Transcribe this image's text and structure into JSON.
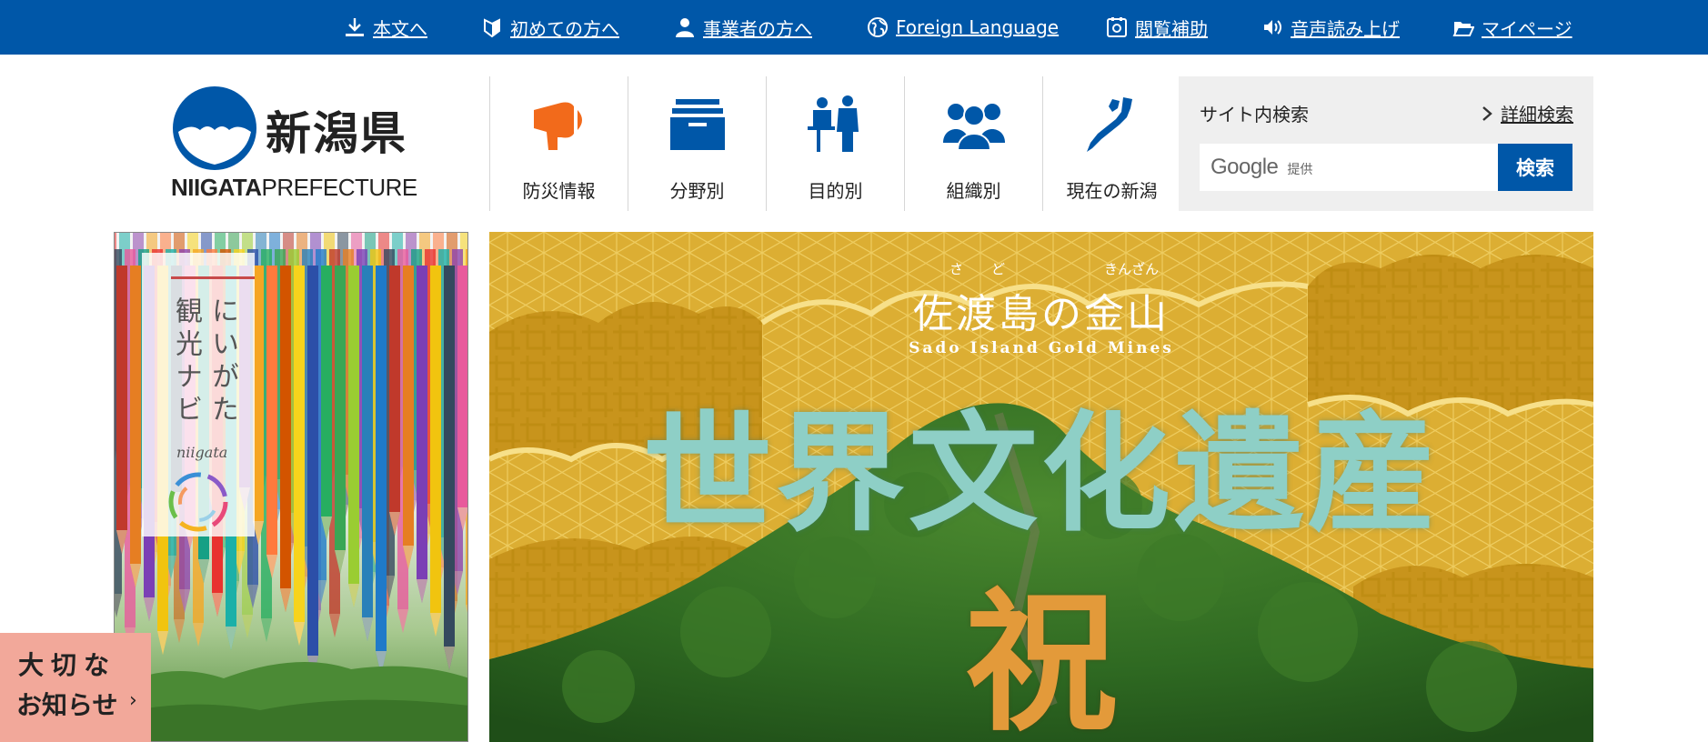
{
  "topbar": {
    "links": [
      {
        "label": "本文へ",
        "icon": "download-arrow-icon"
      },
      {
        "label": "初めての方へ",
        "icon": "beginner-mark-icon"
      },
      {
        "label": "事業者の方へ",
        "icon": "person-icon"
      },
      {
        "label": "Foreign Language",
        "icon": "globe-icon"
      },
      {
        "label": "閲覧補助",
        "icon": "accessibility-icon"
      },
      {
        "label": "音声読み上げ",
        "icon": "speaker-icon"
      },
      {
        "label": "マイページ",
        "icon": "folder-icon"
      }
    ]
  },
  "logo": {
    "name_jp": "新潟県",
    "name_en_bold": "NIIGATA",
    "name_en_rest": "PREFECTURE"
  },
  "nav": {
    "tiles": [
      {
        "label": "防災情報",
        "icon": "megaphone-icon",
        "color": "#f26a1b"
      },
      {
        "label": "分野別",
        "icon": "filing-box-icon",
        "color": "#0057a8"
      },
      {
        "label": "目的別",
        "icon": "consultation-icon",
        "color": "#0057a8"
      },
      {
        "label": "組織別",
        "icon": "group-icon",
        "color": "#0057a8"
      },
      {
        "label": "現在の新潟",
        "icon": "niigata-map-icon",
        "color": "#0057a8"
      }
    ]
  },
  "search": {
    "title": "サイト内検索",
    "advanced_label": "詳細検索",
    "google_label": "Google",
    "provided_label": "提供",
    "button_label": "検索"
  },
  "tourism": {
    "col1": "にいがた",
    "col2": "観光ナビ",
    "sub": "niigata"
  },
  "notice": {
    "line1": "大切な",
    "line2": "お知らせ"
  },
  "hero": {
    "ruby_sa": "さ",
    "ruby_do": "ど",
    "ruby_kinzan": "きんざん",
    "subtitle": "佐渡島の金山",
    "english": "Sado Island Gold Mines",
    "main": "世界文化遺産",
    "celebrate": "祝"
  },
  "colors": {
    "brand_blue": "#0057a8",
    "disaster_orange": "#f26a1b",
    "notice_pink": "#f2a89a",
    "hero_gold": "#d9a92f",
    "hero_teal": "#8ecfc6"
  }
}
